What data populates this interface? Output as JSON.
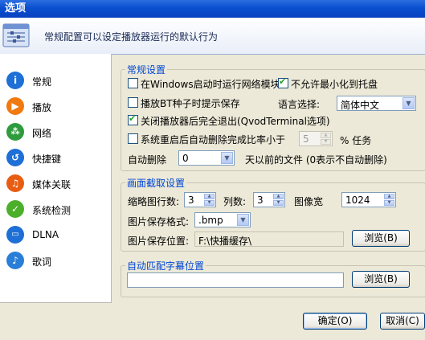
{
  "window": {
    "title": "选项"
  },
  "header": {
    "description": "常规配置可以设定播放器运行的默认行为",
    "icon": "settings-panel-icon"
  },
  "sidebar": {
    "items": [
      {
        "label": "常规",
        "icon": "info-icon",
        "color": "#1E6FD6"
      },
      {
        "label": "播放",
        "icon": "play-icon",
        "color": "#F07A10"
      },
      {
        "label": "网络",
        "icon": "network-icon",
        "color": "#2E9B3C"
      },
      {
        "label": "快捷键",
        "icon": "shortcut-icon",
        "color": "#1E6FD6"
      },
      {
        "label": "媒体关联",
        "icon": "media-association-icon",
        "color": "#E85D12"
      },
      {
        "label": "系统检测",
        "icon": "system-check-icon",
        "color": "#4CAF2A"
      },
      {
        "label": "DLNA",
        "icon": "dlna-icon",
        "color": "#1E6FD6"
      },
      {
        "label": "歌词",
        "icon": "lyrics-icon",
        "color": "#2A7ED8"
      }
    ]
  },
  "general": {
    "title": "常规设置",
    "opt_startup": {
      "label": "在Windows启动时运行网络模块",
      "checked": false
    },
    "opt_no_minimize": {
      "label": "不允许最小化到托盘",
      "checked": true
    },
    "opt_bt_prompt": {
      "label": "播放BT种子时提示保存",
      "checked": false
    },
    "language_label": "语言选择:",
    "language_value": "简体中文",
    "opt_full_exit": {
      "label": "关闭播放器后完全退出(QvodTerminal选项)",
      "checked": true
    },
    "opt_auto_delete": {
      "label": "系统重启后自动删除完成比率小于",
      "checked": false
    },
    "ratio_value": "5",
    "ratio_suffix": "% 任务",
    "auto_delete_label": "自动删除",
    "auto_delete_value": "0",
    "auto_delete_suffix": "天以前的文件 (0表示不自动删除)"
  },
  "capture": {
    "title": "画面截取设置",
    "thumb_rows_label": "缩略图行数:",
    "thumb_rows_value": "3",
    "columns_label": "列数:",
    "columns_value": "3",
    "image_width_label": "图像宽",
    "image_width_value": "1024",
    "format_label": "图片保存格式:",
    "format_value": ".bmp",
    "save_path_label": "图片保存位置:",
    "save_path_value": "F:\\快播缓存\\",
    "browse_label": "浏览(B)"
  },
  "subtitle": {
    "title": "自动匹配字幕位置",
    "path_value": "",
    "browse_label": "浏览(B)"
  },
  "footer": {
    "ok_label": "确定(O)",
    "cancel_label": "取消(C)"
  }
}
